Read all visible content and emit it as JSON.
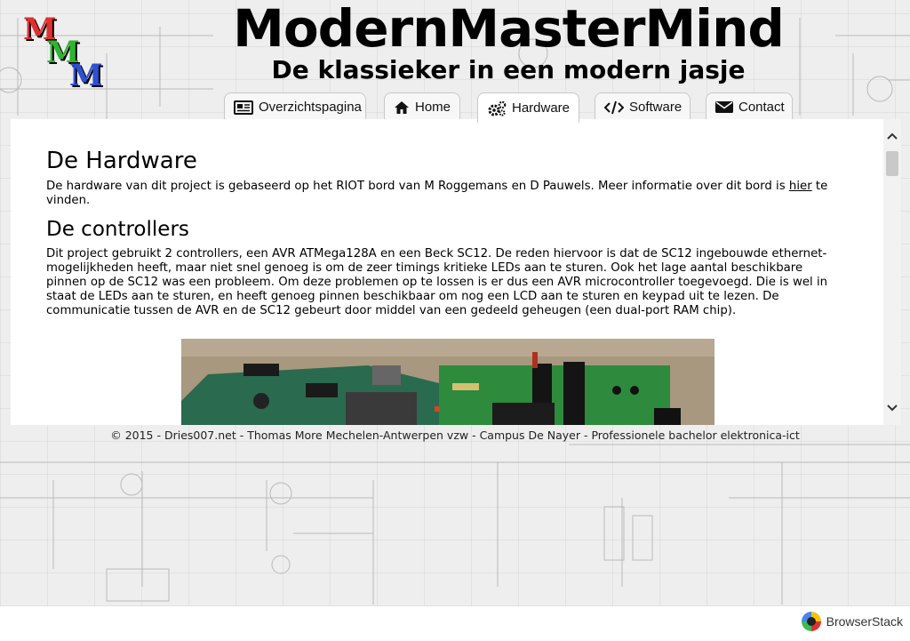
{
  "logo": {
    "letters": [
      "M",
      "M",
      "M"
    ]
  },
  "site": {
    "title": "ModernMasterMind",
    "subtitle": "De klassieker in een modern jasje"
  },
  "nav": {
    "tabs": [
      {
        "label": "Overzichtspagina",
        "icon": "newspaper-icon"
      },
      {
        "label": "Home",
        "icon": "home-icon"
      },
      {
        "label": "Hardware",
        "icon": "cogs-icon",
        "active": true
      },
      {
        "label": "Software",
        "icon": "code-icon"
      },
      {
        "label": "Contact",
        "icon": "envelope-icon"
      }
    ]
  },
  "main": {
    "heading": "De Hardware",
    "intro_before_link": "De hardware van dit project is gebaseerd op het RIOT bord van M Roggemans en D Pauwels. Meer informatie over dit bord is ",
    "intro_link": "hier",
    "intro_after_link": " te vinden.",
    "controllers_heading": "De controllers",
    "controllers_text": "Dit project gebruikt 2 controllers, een AVR ATMega128A en een Beck SC12. De reden hiervoor is dat de SC12 ingebouwde ethernet-mogelijkheden heeft, maar niet snel genoeg is om de zeer timings kritieke LEDs aan te sturen. Ook het lage aantal beschikbare pinnen op de SC12 was een probleem. Om deze problemen op te lossen is er dus een AVR microcontroller toegevoegd. Die is wel in staat de LEDs aan te sturen, en heeft genoeg pinnen beschikbaar om nog een LCD aan te sturen en keypad uit te lezen. De communicatie tussen de AVR en de SC12 gebeurt door middel van een gedeeld geheugen (een dual-port RAM chip)."
  },
  "footer": {
    "text": "© 2015 - Dries007.net - Thomas More Mechelen-Antwerpen vzw - Campus De Nayer - Professionele bachelor elektronica-ict"
  },
  "browserstack": {
    "label": "BrowserStack"
  },
  "colors": {
    "accent_red": "#e03030",
    "accent_green": "#2fb42f",
    "accent_blue": "#2f50d0"
  }
}
